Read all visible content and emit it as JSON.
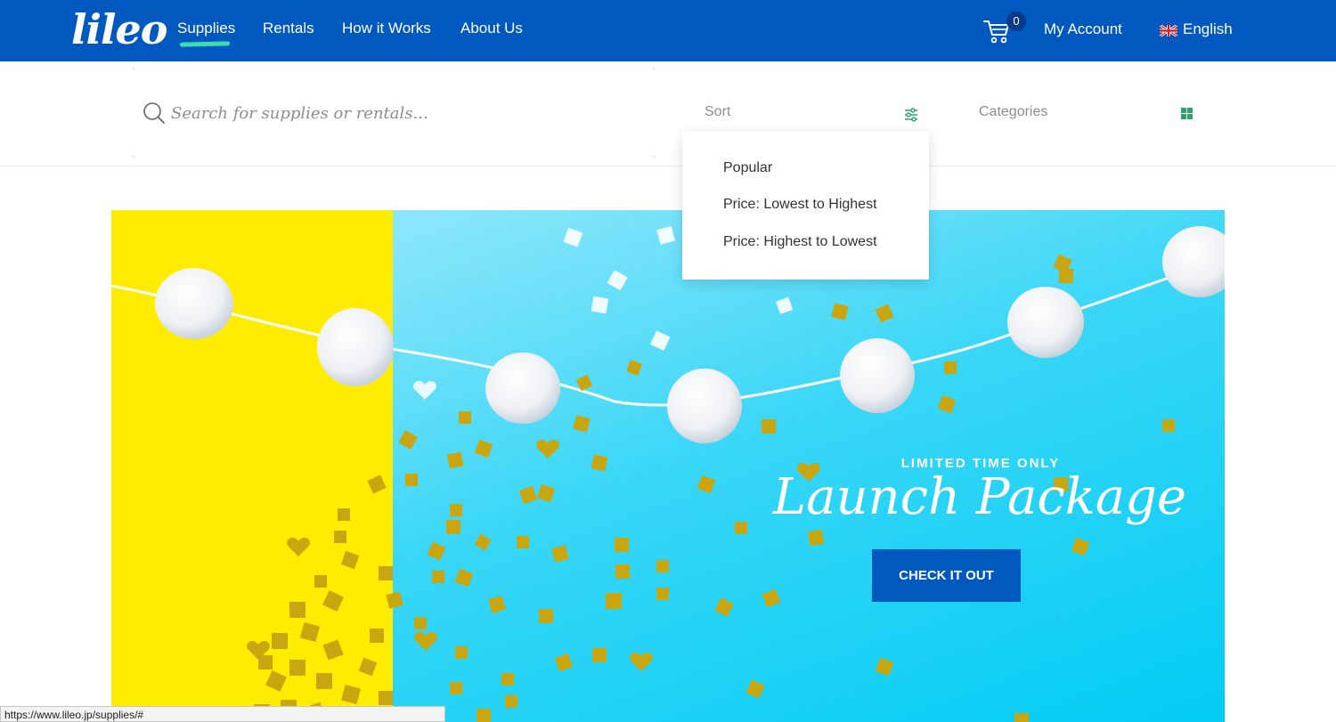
{
  "header": {
    "logo": "lileo",
    "nav": [
      {
        "label": "Supplies",
        "active": true
      },
      {
        "label": "Rentals",
        "active": false
      },
      {
        "label": "How it Works",
        "active": false
      },
      {
        "label": "About Us",
        "active": false
      }
    ],
    "cart_count": "0",
    "account_label": "My Account",
    "language_label": "English",
    "language_flag_icon": "uk-flag-icon",
    "cart_icon": "cart-icon"
  },
  "filter": {
    "search_placeholder": "Search for supplies or rentals...",
    "search_value": "",
    "sort_label": "Sort",
    "categories_label": "Categories",
    "sort_icon": "sliders-icon",
    "categories_icon": "grid-icon"
  },
  "sort_dropdown": {
    "open": true,
    "options": [
      "Popular",
      "Price: Lowest to Highest",
      "Price: Highest to Lowest"
    ]
  },
  "banner": {
    "eyebrow": "LIMITED TIME ONLY",
    "title": "Launch Package",
    "button_label": "CHECK IT OUT"
  },
  "status_url": "https://www.lileo.jp/supplies/#",
  "colors": {
    "brand_blue": "#0158bf",
    "accent_green": "#38e0b0",
    "banner_yellow": "#ffec00",
    "banner_cyan": "#03ccf3"
  }
}
